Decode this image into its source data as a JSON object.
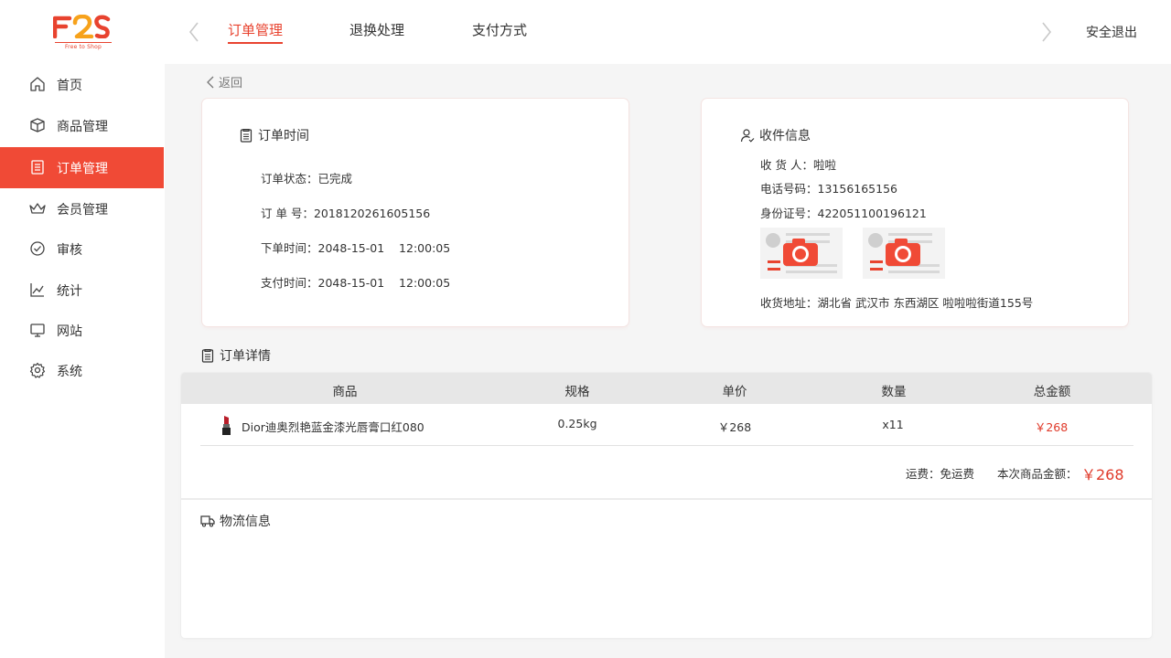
{
  "header": {
    "logo_text": "F2S",
    "logo_tagline": "Free to Shop",
    "tabs": [
      {
        "label": "订单管理",
        "active": true
      },
      {
        "label": "退换处理",
        "active": false
      },
      {
        "label": "支付方式",
        "active": false
      }
    ],
    "nav_prev_icon": "chevron-left-icon",
    "nav_next_icon": "chevron-right-icon",
    "logout_label": "安全退出"
  },
  "sidebar": {
    "items": [
      {
        "label": "首页",
        "icon": "home-icon",
        "active": false
      },
      {
        "label": "商品管理",
        "icon": "box-icon",
        "active": false
      },
      {
        "label": "订单管理",
        "icon": "document-icon",
        "active": true
      },
      {
        "label": "会员管理",
        "icon": "crown-icon",
        "active": false
      },
      {
        "label": "审核",
        "icon": "check-circle-icon",
        "active": false
      },
      {
        "label": "统计",
        "icon": "line-chart-icon",
        "active": false
      },
      {
        "label": "网站",
        "icon": "monitor-icon",
        "active": false
      },
      {
        "label": "系统",
        "icon": "gear-icon",
        "active": false
      }
    ]
  },
  "back_label": "返回",
  "order_time_card": {
    "title": "订单时间",
    "rows": [
      {
        "key": "订单状态：",
        "value": "已完成"
      },
      {
        "key": "订 单 号：",
        "value": "2018120261605156"
      },
      {
        "key": "下单时间：",
        "value": "2048-15-01    12:00:05"
      },
      {
        "key": "支付时间：",
        "value": "2048-15-01    12:00:05"
      }
    ]
  },
  "receiver_card": {
    "title": "收件信息",
    "rows": [
      {
        "key": "收 货 人：",
        "value": "啦啦"
      },
      {
        "key": "电话号码：",
        "value": "13156165156"
      },
      {
        "key": "身份证号：",
        "value": "422051100196121"
      }
    ],
    "address_key": "收货地址：",
    "address_value": "湖北省 武汉市 东西湖区 啦啦啦街道155号"
  },
  "order_details": {
    "title": "订单详情",
    "columns": [
      "商品",
      "规格",
      "单价",
      "数量",
      "总金额"
    ],
    "rows": [
      {
        "product": "Dior迪奥烈艳蓝金漆光唇膏口红080",
        "spec": "0.25kg",
        "unit_price": "￥268",
        "quantity": "x11",
        "total": "￥268"
      }
    ],
    "shipping_label": "运费：免运费",
    "amount_label": "本次商品金额：",
    "amount_value": "￥268",
    "accent_color": "#e03a2a"
  },
  "logistics": {
    "title": "物流信息"
  },
  "colors": {
    "brand": "#f04a36",
    "price": "#e03a2a"
  }
}
